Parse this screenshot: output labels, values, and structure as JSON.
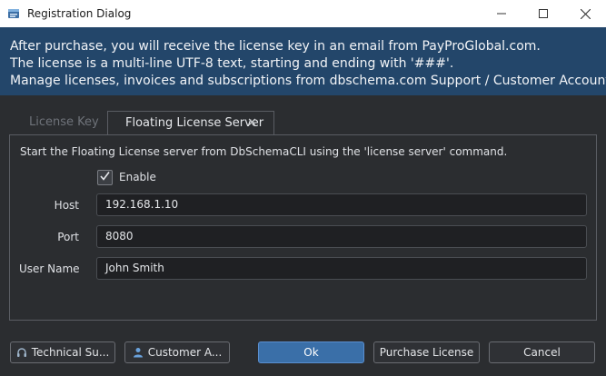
{
  "window": {
    "title": "Registration Dialog",
    "icon": "dbschema-app-icon"
  },
  "banner": {
    "lines": [
      "After purchase, you will receive the license key in an email from PayProGlobal.com.",
      "The license is a multi-line UTF-8 text, starting and ending with '###'.",
      "Manage licenses, invoices and subscriptions from dbschema.com Support / Customer Account."
    ]
  },
  "tabs": [
    {
      "label": "License Key",
      "active": false
    },
    {
      "label": "Floating License Server",
      "active": true,
      "close_glyph": "✕"
    }
  ],
  "panel": {
    "description": "Start the Floating License server from DbSchemaCLI using the 'license server' command.",
    "enable": {
      "label": "Enable",
      "checked": true,
      "check_glyph": "✓"
    },
    "host": {
      "label": "Host",
      "value": "192.168.1.10"
    },
    "port": {
      "label": "Port",
      "value": "8080"
    },
    "user": {
      "label": "User Name",
      "value": "John Smith"
    }
  },
  "buttons": {
    "technical_support": "Technical Su...",
    "customer_account": "Customer A...",
    "ok": "Ok",
    "purchase_license": "Purchase License",
    "cancel": "Cancel"
  },
  "colors": {
    "banner_bg": "#23466a",
    "dialog_bg": "#2b2d30",
    "ok_button": "#3a6fa8"
  }
}
